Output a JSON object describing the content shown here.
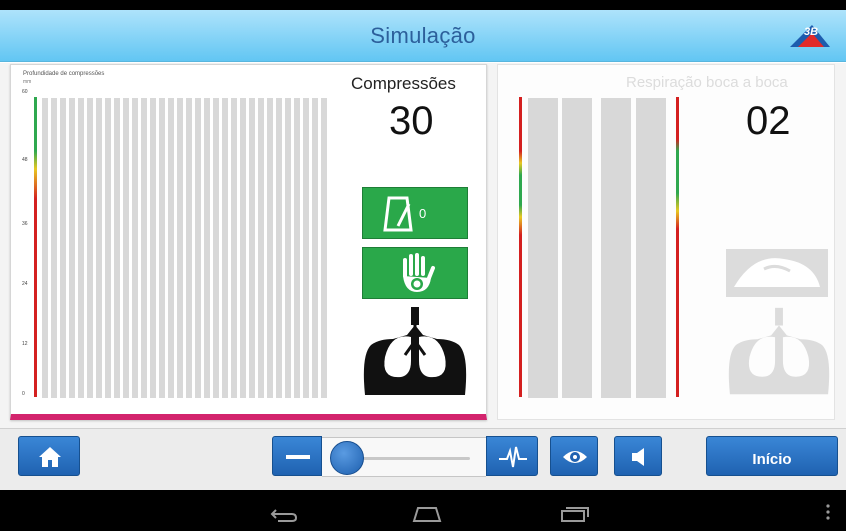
{
  "app": {
    "title": "Simulação",
    "logo_text": "3B"
  },
  "left_panel": {
    "graph_title": "Profundidade de compressões",
    "graph_unit": "mm",
    "y_ticks": [
      "60",
      "48",
      "36",
      "24",
      "12",
      "0"
    ],
    "compressions_label": "Compressões",
    "compressions_value": "30",
    "metronome_count": "0"
  },
  "right_panel": {
    "title": "Respiração boca a boca",
    "breaths_value": "02"
  },
  "toolbar": {
    "start_label": "Início"
  },
  "colors": {
    "accent_blue": "#1f62b1",
    "title_blue": "#62c6f3",
    "green": "#2aa84a",
    "magenta": "#d3246d",
    "red": "#d42020",
    "yellow": "#f2d21b"
  },
  "icons": [
    "logo-icon",
    "home-icon",
    "minus-icon",
    "pulse-icon",
    "eye-icon",
    "speaker-icon",
    "metronome-icon",
    "hand-icon",
    "lungs-icon",
    "face-icon",
    "back-icon",
    "home-nav-icon",
    "recents-icon",
    "menu-dots-icon"
  ]
}
